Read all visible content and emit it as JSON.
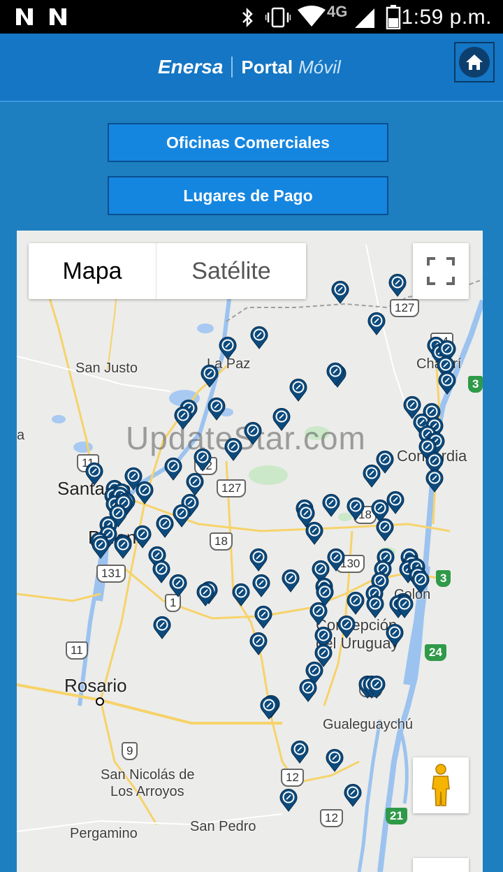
{
  "status_bar": {
    "time": "1:59 p.m.",
    "network": "4G",
    "icons": [
      "n-notification-icon",
      "n-notification-icon",
      "bluetooth-icon",
      "vibrate-icon",
      "wifi-icon",
      "signal-icon",
      "battery-icon"
    ]
  },
  "header": {
    "brand_name": "Enersa",
    "portal_label": "Portal",
    "portal_suffix": "Móvil",
    "home_icon": "home-icon"
  },
  "buttons": {
    "oficinas": "Oficinas Comerciales",
    "lugares": "Lugares de Pago"
  },
  "map": {
    "type_selected": "Mapa",
    "type_other": "Satélite",
    "watermark": "UpdateStar.com",
    "places": {
      "san_justo": "San Justo",
      "la_paz": "La Paz",
      "santa_fe": "Santa Fe",
      "parana": "Paraná",
      "concordia": "Concordia",
      "chajari": "Chajarí",
      "colon": "Colón",
      "concepcion1": "Concepción",
      "concepcion2": "del Uruguay",
      "rosario": "Rosario",
      "gualeguaychu": "Gualeguaychú",
      "san_nicolas1": "San Nicolás de",
      "san_nicolas2": "Los Arroyos",
      "pergamino": "Pergamino",
      "san_pedro": "San Pedro",
      "edge_a": "a"
    },
    "routes": {
      "r11a": "11",
      "r11b": "11",
      "r12a": "12",
      "r12b": "12",
      "r12c": "12",
      "r127a": "127",
      "r127b": "127",
      "r18a": "18",
      "r18b": "18",
      "r130": "130",
      "r131": "131",
      "r14a": "14",
      "r14b": "14",
      "r9": "9",
      "r3a": "3",
      "r3b": "3",
      "r24": "24",
      "r21": "21",
      "r1x": "1"
    },
    "controls": {
      "fullscreen_icon": "fullscreen-icon",
      "pegman_icon": "pegman-icon"
    },
    "marker_icon": "payment-location-pin-icon",
    "marker_count": 110
  },
  "colors": {
    "page_bg": "#1d7fc0",
    "header_bg": "#1476c4",
    "button_bg": "#1586e0",
    "marker": "#0d4a7c"
  }
}
